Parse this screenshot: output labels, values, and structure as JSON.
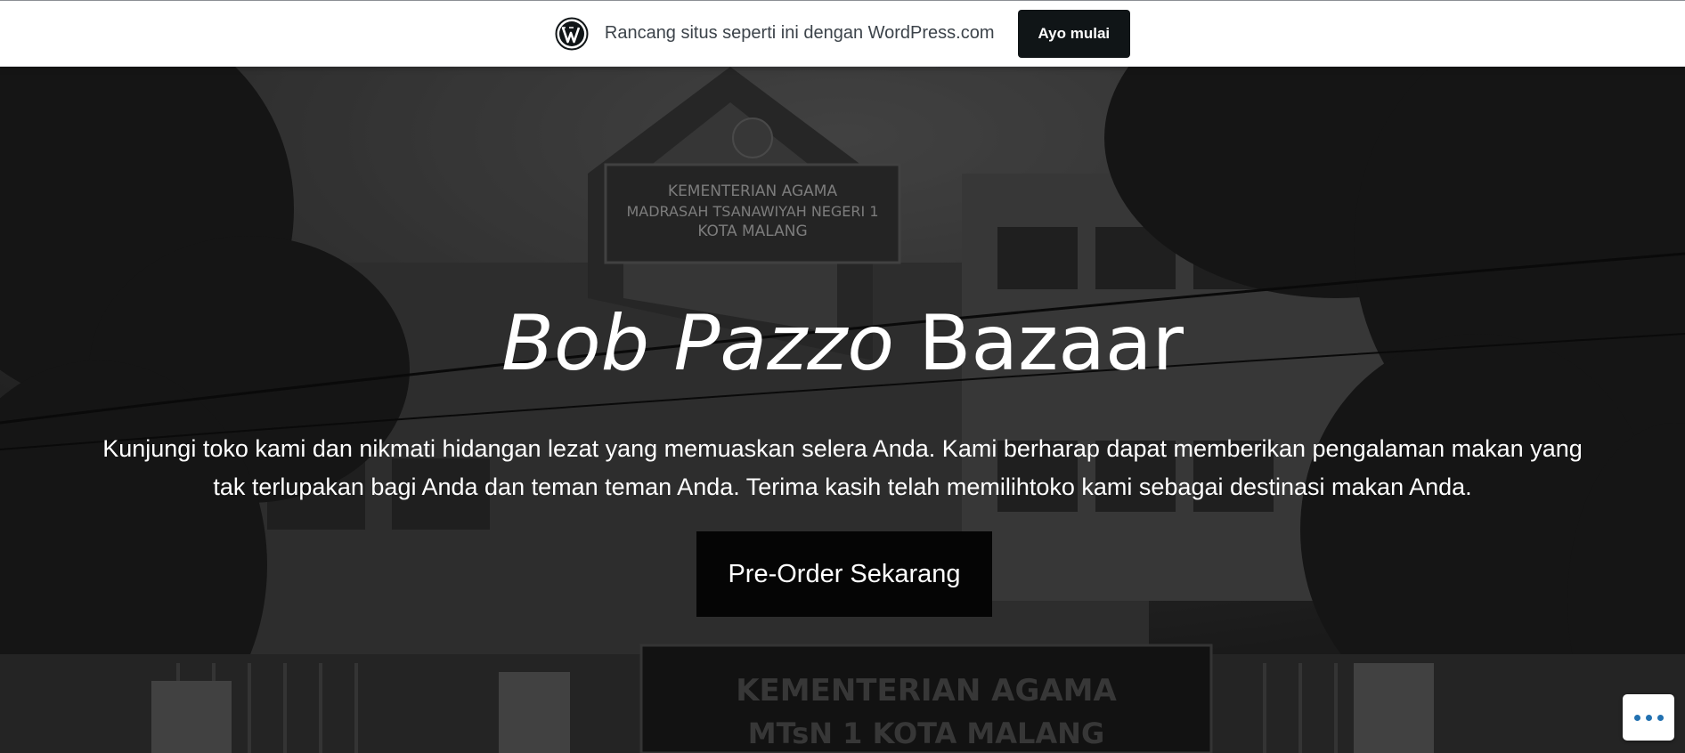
{
  "banner": {
    "logo_icon": "wordpress-logo-icon",
    "text": "Rancang situs seperti ini dengan WordPress.com",
    "cta_label": "Ayo mulai"
  },
  "hero": {
    "title_italic": "Bob Pazzo",
    "title_rest": " Bazaar",
    "description": "Kunjungi toko kami dan nikmati hidangan lezat yang memuaskan selera Anda. Kami berharap dapat memberikan pengalaman makan yang tak terlupakan bagi Anda dan teman teman Anda. Terima kasih telah memilihtoko kami sebagai destinasi makan Anda.",
    "cta_label": "Pre-Order Sekarang",
    "background_image": "school-building-photo",
    "photo_sign": {
      "line1": "KEMENTERIAN AGAMA",
      "line2": "MADRASAH TSANAWIYAH NEGERI 1",
      "line3": "KOTA MALANG",
      "gate_line1": "KEMENTERIAN AGAMA",
      "gate_line2": "MTsN 1 KOTA MALANG"
    }
  },
  "fab": {
    "icon": "ellipsis-icon"
  },
  "colors": {
    "banner_bg": "#ffffff",
    "banner_cta_bg": "#101517",
    "hero_cta_bg": "#050505",
    "hero_text": "#ffffff"
  }
}
